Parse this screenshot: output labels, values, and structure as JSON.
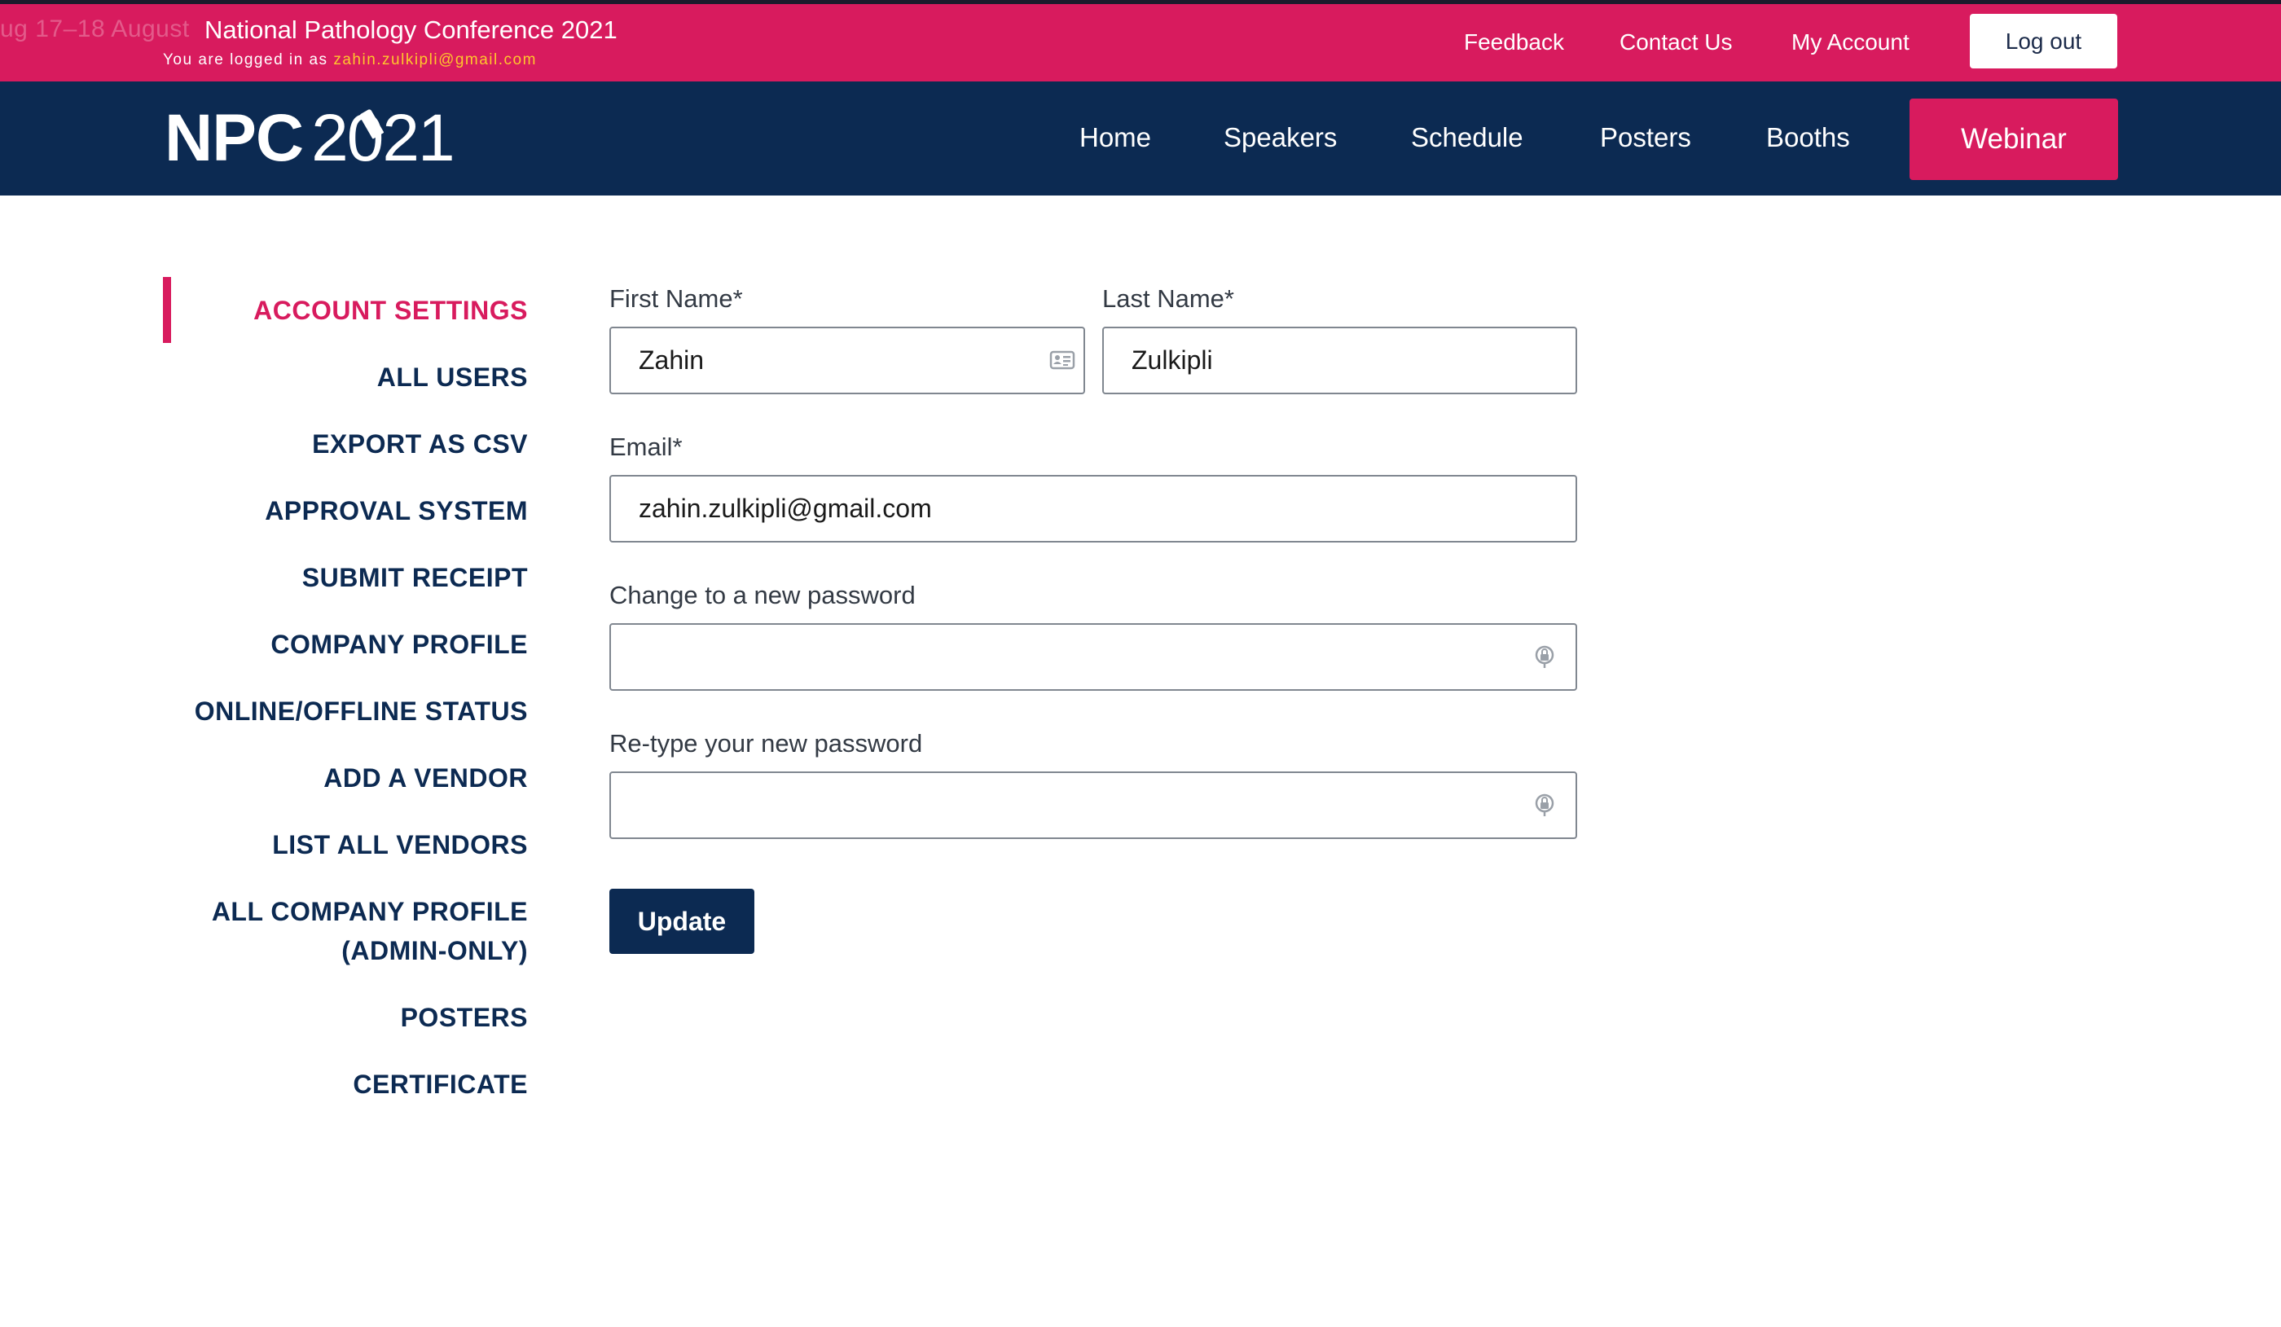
{
  "topbar": {
    "marquee_ghost": "ug 17–18 August",
    "conference_title": "National Pathology Conference 2021",
    "logged_in_prefix": "You are logged in as",
    "logged_in_email": "zahin.zulkipli@gmail.com",
    "links": [
      "Feedback",
      "Contact Us",
      "My Account"
    ],
    "logout_label": "Log out",
    "bg_color": "#d81b5e"
  },
  "navbar": {
    "logo_text": "NPC",
    "logo_year": "2021",
    "links": [
      "Home",
      "Speakers",
      "Schedule",
      "Posters",
      "Booths"
    ],
    "webinar_label": "Webinar",
    "bg_color": "#0c2a52"
  },
  "sidebar": {
    "active_index": 0,
    "items": [
      "ACCOUNT SETTINGS",
      "ALL USERS",
      "EXPORT AS CSV",
      "APPROVAL SYSTEM",
      "SUBMIT RECEIPT",
      "COMPANY PROFILE",
      "ONLINE/OFFLINE STATUS",
      "ADD A VENDOR",
      "LIST ALL VENDORS",
      "ALL COMPANY PROFILE",
      "(ADMIN-ONLY)",
      "POSTERS",
      "CERTIFICATE"
    ]
  },
  "form": {
    "first_name": {
      "label": "First Name*",
      "value": "Zahin",
      "icon": "contact-card-icon"
    },
    "last_name": {
      "label": "Last Name*",
      "value": "Zulkipli"
    },
    "email": {
      "label": "Email*",
      "value": "zahin.zulkipli@gmail.com"
    },
    "new_password": {
      "label": "Change to a new password",
      "value": "",
      "icon": "password-key-icon"
    },
    "retype_password": {
      "label": "Re-type your new password",
      "value": "",
      "icon": "password-key-icon"
    },
    "update_label": "Update"
  }
}
